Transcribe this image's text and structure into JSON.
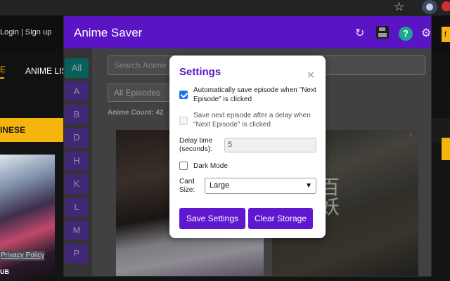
{
  "browser": {
    "star_icon": "star-icon",
    "extension_icon": "extension-icon"
  },
  "site": {
    "login_text": "Login | Sign up",
    "nav_home": "E",
    "nav_anime_list": "ANIME LIS",
    "section_label": "INESE",
    "poster_badge": "UB",
    "right_strip_text": "f"
  },
  "popup": {
    "title": "Anime Saver",
    "header_icons": [
      "refresh-icon",
      "save-icon",
      "help-icon",
      "gear-icon"
    ],
    "help_label": "?",
    "alphabet": [
      "All",
      "A",
      "B",
      "D",
      "H",
      "K",
      "L",
      "M",
      "P"
    ],
    "active_letter": "All",
    "search_placeholder": "Search Anime",
    "filter_value": "All Episodes",
    "anime_count_label": "Anime Count:",
    "anime_count": "42",
    "card_title_glyphs": "百\n妖",
    "card_close": "×",
    "privacy_link": "Privacy Policy"
  },
  "settings": {
    "title": "Settings",
    "close": "×",
    "auto_save_label": "Automatically save episode when \"Next Episode\" is clicked",
    "auto_save_checked": true,
    "delay_save_label": "Save next episode after a delay when \"Next Episode\" is clicked",
    "delay_save_checked": false,
    "delay_label": "Delay time (seconds):",
    "delay_value": "5",
    "dark_mode_label": "Dark Mode",
    "dark_mode_checked": false,
    "card_size_label": "Card Size:",
    "card_size_value": "Large",
    "save_button": "Save Settings",
    "clear_button": "Clear Storage"
  },
  "colors": {
    "brand_purple": "#5a14c4",
    "button_purple": "#5f17cf",
    "active_teal": "#0c9c94",
    "accent_yellow": "#f5b50c"
  }
}
